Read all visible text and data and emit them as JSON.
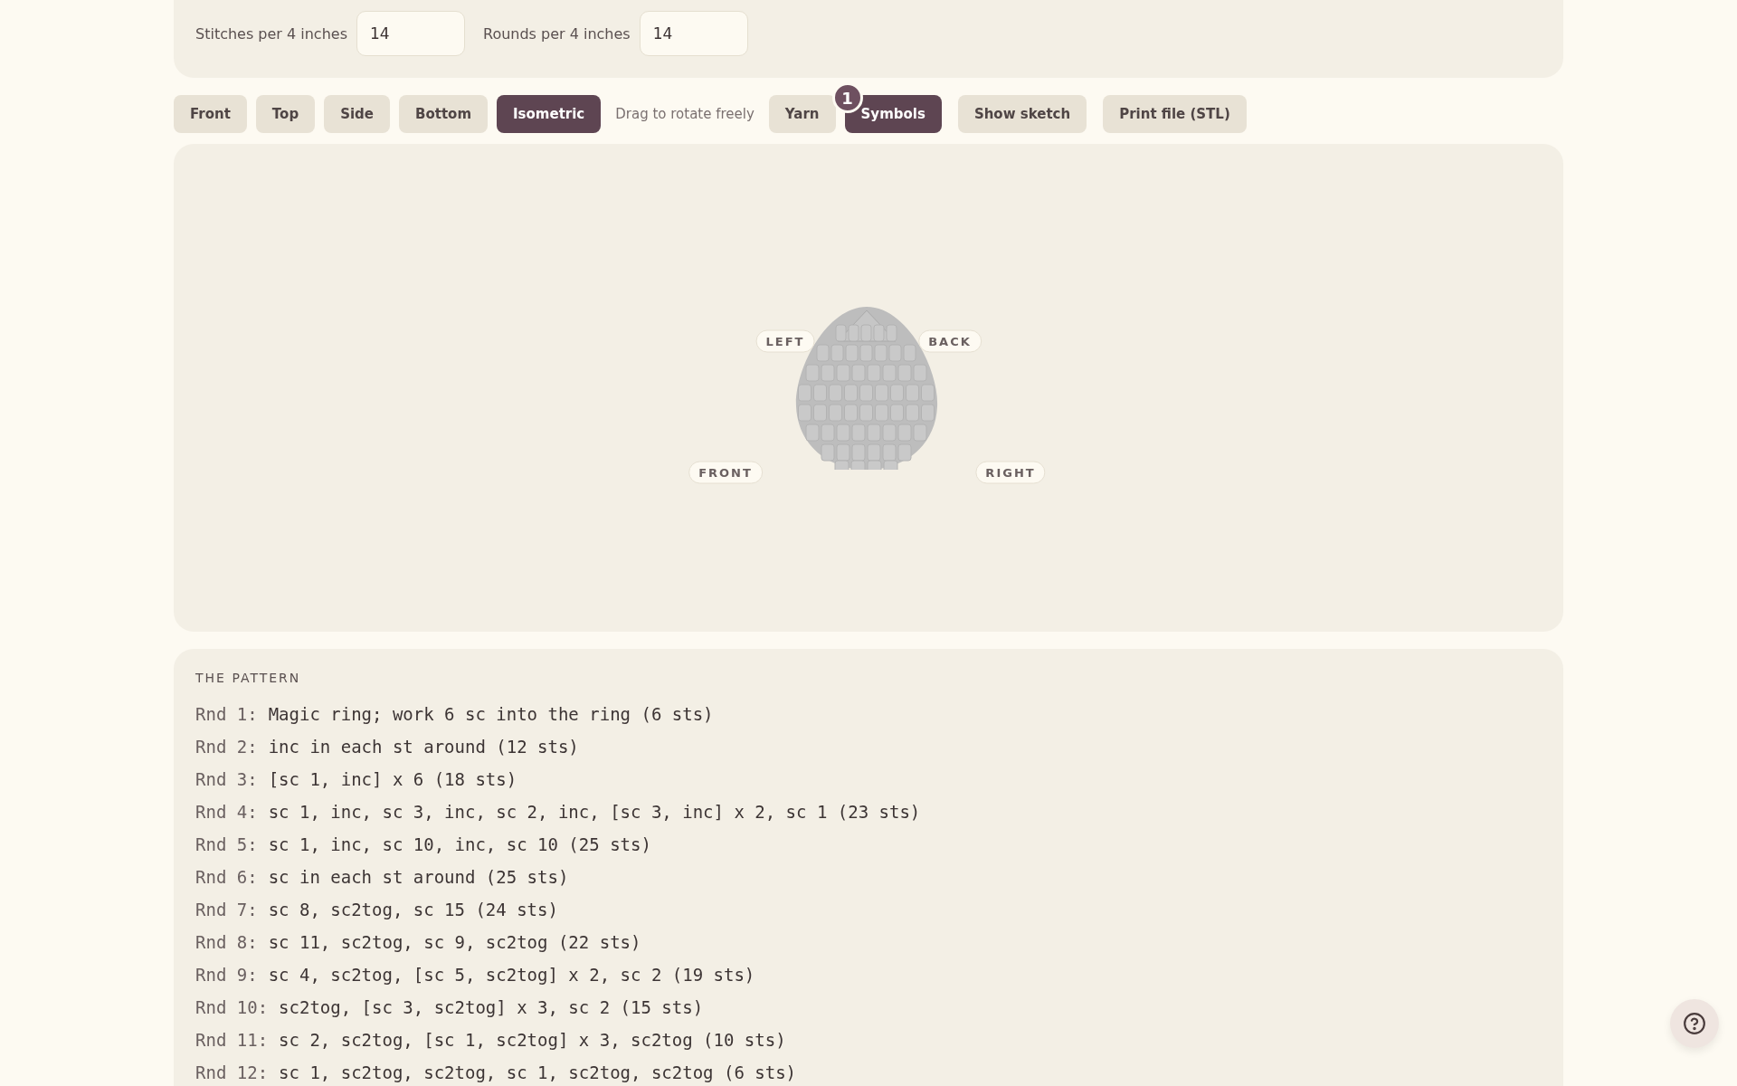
{
  "gauge": {
    "fields": [
      {
        "label": "Stitches per 4 inches",
        "value": "14"
      },
      {
        "label": "Rounds per 4 inches",
        "value": "14"
      }
    ]
  },
  "views": [
    {
      "label": "Front",
      "selected": false
    },
    {
      "label": "Top",
      "selected": false
    },
    {
      "label": "Side",
      "selected": false
    },
    {
      "label": "Bottom",
      "selected": false
    },
    {
      "label": "Isometric",
      "selected": true
    }
  ],
  "view_hint": "Drag to rotate freely",
  "display": [
    {
      "label": "Yarn",
      "selected": false
    },
    {
      "label": "Symbols",
      "selected": true
    }
  ],
  "display_badge": "1",
  "actions": [
    "Show sketch",
    "Print file (STL)"
  ],
  "viewer": {
    "axis_labels": [
      "LEFT",
      "BACK",
      "FRONT",
      "RIGHT"
    ]
  },
  "pattern": {
    "title": "THE PATTERN",
    "rounds": [
      {
        "label": "Rnd 1:",
        "text": "Magic ring; work 6 sc into the ring (6 sts)"
      },
      {
        "label": "Rnd 2:",
        "text": "inc in each st around (12 sts)"
      },
      {
        "label": "Rnd 3:",
        "text": "[sc 1, inc] x 6 (18 sts)"
      },
      {
        "label": "Rnd 4:",
        "text": "sc 1, inc, sc 3, inc, sc 2, inc, [sc 3, inc] x 2, sc 1 (23 sts)"
      },
      {
        "label": "Rnd 5:",
        "text": "sc 1, inc, sc 10, inc, sc 10 (25 sts)"
      },
      {
        "label": "Rnd 6:",
        "text": "sc in each st around (25 sts)"
      },
      {
        "label": "Rnd 7:",
        "text": "sc 8, sc2tog, sc 15 (24 sts)"
      },
      {
        "label": "Rnd 8:",
        "text": "sc 11, sc2tog, sc 9, sc2tog (22 sts)"
      },
      {
        "label": "Rnd 9:",
        "text": "sc 4, sc2tog, [sc 5, sc2tog] x 2, sc 2 (19 sts)"
      },
      {
        "label": "Rnd 10:",
        "text": "sc2tog, [sc 3, sc2tog] x 3, sc 2 (15 sts)"
      },
      {
        "label": "Rnd 11:",
        "text": "sc 2, sc2tog, [sc 1, sc2tog] x 3, sc2tog (10 sts)"
      },
      {
        "label": "Rnd 12:",
        "text": "sc 1, sc2tog, sc2tog, sc 1, sc2tog, sc2tog (6 sts)"
      }
    ]
  }
}
